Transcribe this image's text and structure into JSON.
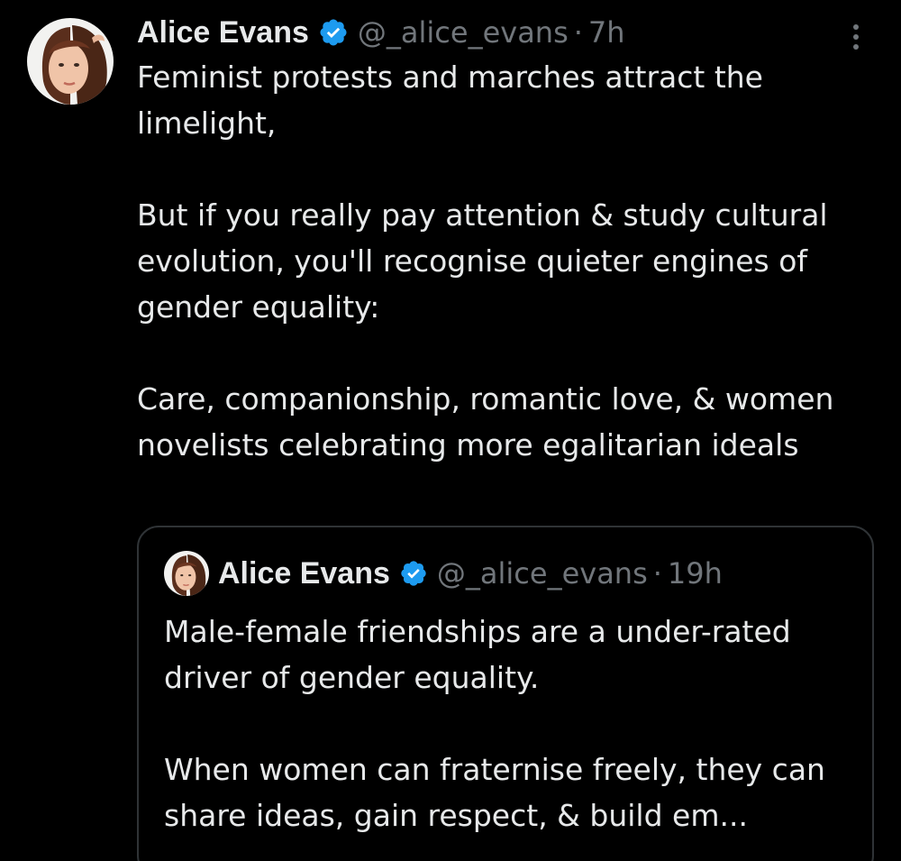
{
  "tweet": {
    "author": {
      "name": "Alice Evans",
      "handle": "@_alice_evans",
      "verified_icon": "verified-badge-icon"
    },
    "separator": "·",
    "time": "7h",
    "more_icon": "more-vertical-icon",
    "text": {
      "p1": "Feminist protests and marches attract the limelight,",
      "p2": "But if you really pay attention & study cultural evolution, you'll recognise quieter engines of gender equality:",
      "p3": "Care, companionship, romantic love, & women novelists celebrating more egalitarian ideals"
    }
  },
  "quoted": {
    "author": {
      "name": "Alice Evans",
      "handle": "@_alice_evans",
      "verified_icon": "verified-badge-icon"
    },
    "separator": "·",
    "time": "19h",
    "text": {
      "p1": "Male-female friendships are a under-rated driver of gender equality.",
      "p2": "When women can fraternise freely, they can share ideas, gain respect, & build em..."
    }
  },
  "colors": {
    "background": "#000000",
    "text_primary": "#e7e9ea",
    "text_secondary": "#71767b",
    "verified_blue": "#1d9bf0",
    "border": "#2f3336"
  }
}
